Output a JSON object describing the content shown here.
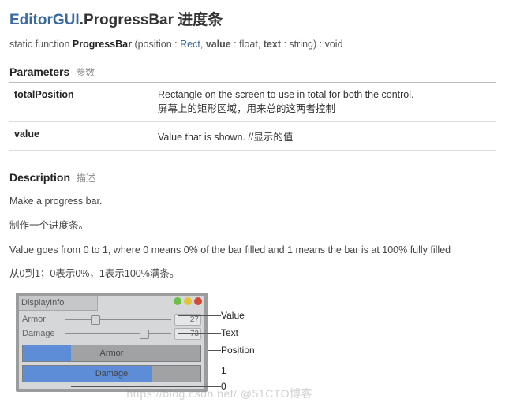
{
  "title": {
    "class": "EditorGUI",
    "method": ".ProgressBar",
    "cn": "进度条"
  },
  "signature": {
    "prefix": "static function",
    "fn": "ProgressBar",
    "p1_name": "position",
    "p1_type": "Rect",
    "p2_name": "value",
    "p2_type": "float",
    "p3_name": "text",
    "p3_type": "string",
    "ret": "void"
  },
  "params_heading": {
    "en": "Parameters",
    "cn": "参数"
  },
  "params": [
    {
      "name": "totalPosition",
      "en": "Rectangle on the screen to use in total for both the control.",
      "cn": "屏幕上的矩形区域，用来总的这两者控制"
    },
    {
      "name": "value",
      "en": "Value that is shown. //显示的值",
      "cn": ""
    }
  ],
  "desc_heading": {
    "en": "Description",
    "cn": "描述"
  },
  "desc": {
    "l1": "Make a progress bar.",
    "l2": "制作一个进度条。",
    "l3": "Value goes from 0 to 1, where 0 means 0% of the bar filled and 1 means the bar is at 100% fully filled",
    "l4": "从0到1；0表示0%，1表示100%满条。"
  },
  "diagram": {
    "window_title": "DisplayInfo",
    "row1_label": "Armor",
    "row1_value": "27",
    "row2_label": "Damage",
    "row2_value": "73",
    "bar1_text": "Armor",
    "bar1_fill_pct": 27,
    "bar2_text": "Damage",
    "bar2_fill_pct": 73,
    "call_value": "Value",
    "call_text": "Text",
    "call_position": "Position",
    "call_one": "1",
    "call_zero": "0"
  },
  "watermark": "https://blog.csdn.net/  @51CTO博客"
}
